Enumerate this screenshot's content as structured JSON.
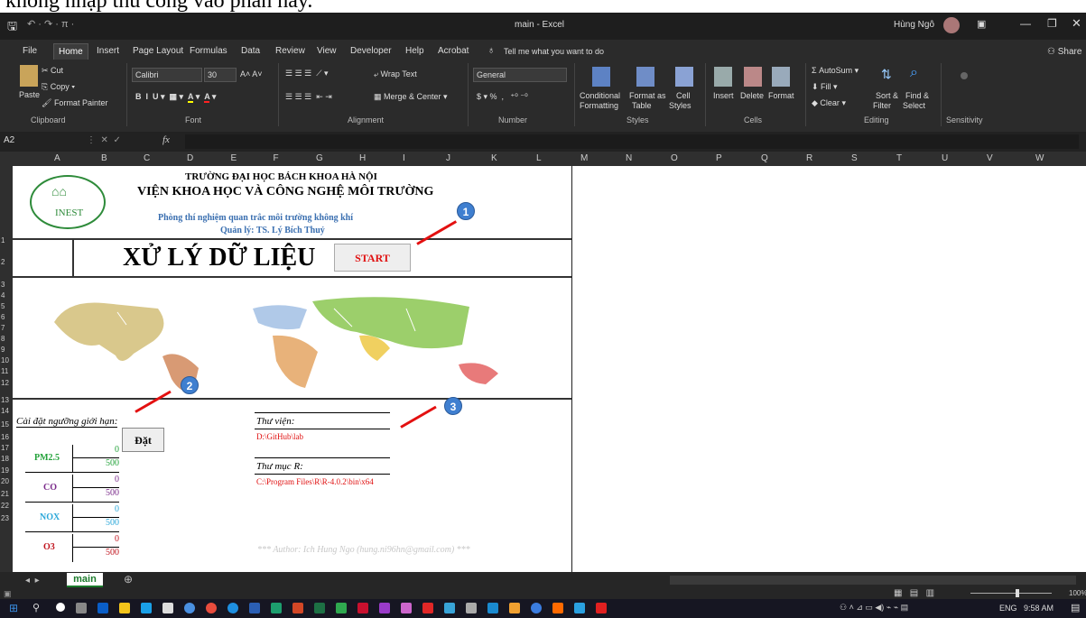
{
  "doc_heading": "không nhập thủ công vào phần này.",
  "window": {
    "title": "main - Excel",
    "user": "Hùng Ngô",
    "share": "Share"
  },
  "tabs": [
    "File",
    "Home",
    "Insert",
    "Page Layout",
    "Formulas",
    "Data",
    "Review",
    "View",
    "Developer",
    "Help",
    "Acrobat"
  ],
  "tell_me": "Tell me what you want to do",
  "clipboard": {
    "paste": "Paste",
    "cut": "Cut",
    "copy": "Copy",
    "format_painter": "Format Painter",
    "label": "Clipboard"
  },
  "font": {
    "name": "Calibri",
    "size": "30",
    "label": "Font"
  },
  "alignment": {
    "wrap": "Wrap Text",
    "merge": "Merge & Center",
    "label": "Alignment"
  },
  "number": {
    "format": "General",
    "label": "Number"
  },
  "styles": {
    "cond1": "Conditional",
    "cond2": "Formatting",
    "fmt1": "Format as",
    "fmt2": "Table",
    "cell1": "Cell",
    "cell2": "Styles",
    "label": "Styles"
  },
  "cells": {
    "insert": "Insert",
    "delete": "Delete",
    "format": "Format",
    "label": "Cells"
  },
  "editing": {
    "autosum": "AutoSum",
    "fill": "Fill",
    "clear": "Clear",
    "sort1": "Sort &",
    "sort2": "Filter",
    "find1": "Find &",
    "find2": "Select",
    "label": "Editing"
  },
  "sensitivity": {
    "label": "Sensitivity"
  },
  "namebox": "A2",
  "columns": [
    "A",
    "B",
    "C",
    "D",
    "E",
    "F",
    "G",
    "H",
    "I",
    "J",
    "K",
    "L",
    "M",
    "N",
    "O",
    "P",
    "Q",
    "R",
    "S",
    "T",
    "U",
    "V",
    "W"
  ],
  "rows": [
    "1",
    "2",
    "3",
    "4",
    "5",
    "6",
    "7",
    "8",
    "9",
    "10",
    "11",
    "12",
    "13",
    "14",
    "15",
    "16",
    "17",
    "18",
    "19",
    "20",
    "21",
    "22",
    "23"
  ],
  "sheet": {
    "logo": "INEST",
    "univ": "TRƯỜNG ĐẠI HỌC BÁCH KHOA HÀ NỘI",
    "inst": "VIỆN KHOA HỌC VÀ CÔNG NGHỆ MÔI TRƯỜNG",
    "lab": "Phòng thí nghiệm quan trắc môi trường không khí",
    "manager": "Quản lý: TS. Lý Bích Thuỷ",
    "main_title": "XỬ LÝ DỮ LIỆU",
    "start": "START",
    "threshold_label": "Cài đặt ngưỡng giới hạn:",
    "set_button": "Đặt",
    "pollutants": [
      {
        "name": "PM2.5",
        "min": "0",
        "max": "500",
        "color": "#23a23a"
      },
      {
        "name": "CO",
        "min": "0",
        "max": "500",
        "color": "#7a2a8a"
      },
      {
        "name": "NOX",
        "min": "0",
        "max": "500",
        "color": "#2aa7d9"
      },
      {
        "name": "O3",
        "min": "0",
        "max": "500",
        "color": "#c0141e"
      }
    ],
    "library_label": "Thư viện:",
    "library_path": "D:\\GitHub\\lab",
    "r_label": "Thư mục R:",
    "r_path": "C:\\Program Files\\R\\R-4.0.2\\bin\\x64",
    "author": "*** Author: Ich Hung Ngo (hung.ni96hn@gmail.com) ***"
  },
  "callouts": [
    "1",
    "2",
    "3"
  ],
  "sheet_tab": "main",
  "zoom": "100%",
  "taskbar": {
    "lang": "ENG",
    "time": "9:58 AM"
  }
}
